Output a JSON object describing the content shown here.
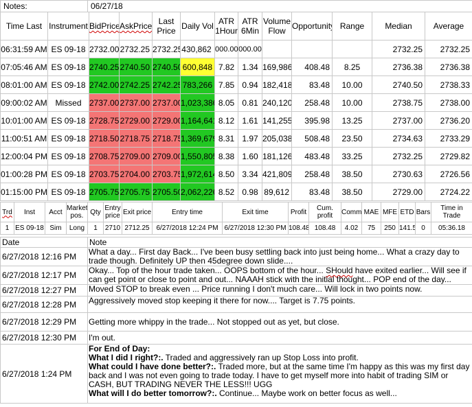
{
  "notes_bar": {
    "label": "Notes:",
    "date": "06/27/18"
  },
  "grid": {
    "headers": {
      "time_last": "Time Last",
      "instrument": "Instrument",
      "bid": "BidPrice",
      "ask": "AskPrice",
      "last": "Last Price",
      "daily_vol": "Daily Vol",
      "atr1": "ATR 1Hour",
      "atr6": "ATR 6Min",
      "volume_flow": "Volume Flow",
      "opportunity": "Opportunity",
      "range": "Range",
      "median": "Median",
      "average": "Average"
    },
    "rows": [
      {
        "time": "06:31:59 AM",
        "inst": "ES 09-18",
        "bid": "2732.00",
        "ask": "2732.25",
        "last": "2732.25",
        "vol": "430,862",
        "atr1": "000.00",
        "atr6": "000.00",
        "flow": "",
        "opp": "",
        "range": "",
        "median": "2732.25",
        "avg": "2732.25"
      },
      {
        "time": "07:05:46 AM",
        "inst": "ES 09-18",
        "bid": "2740.25",
        "ask": "2740.50",
        "last": "2740.50",
        "vol": "600,848",
        "atr1": "7.82",
        "atr6": "1.34",
        "flow": "169,986",
        "opp": "408.48",
        "range": "8.25",
        "median": "2736.38",
        "avg": "2736.38"
      },
      {
        "time": "08:01:00 AM",
        "inst": "ES 09-18",
        "bid": "2742.00",
        "ask": "2742.25",
        "last": "2742.25",
        "vol": "783,266",
        "atr1": "7.85",
        "atr6": "0.94",
        "flow": "182,418",
        "opp": "83.48",
        "range": "10.00",
        "median": "2740.50",
        "avg": "2738.33"
      },
      {
        "time": "09:00:02 AM",
        "inst": "Missed",
        "bid": "2737.00",
        "ask": "2737.00",
        "last": "2737.00",
        "vol": "1,023,386",
        "atr1": "8.05",
        "atr6": "0.81",
        "flow": "240,120",
        "opp": "258.48",
        "range": "10.00",
        "median": "2738.75",
        "avg": "2738.00"
      },
      {
        "time": "10:01:00 AM",
        "inst": "ES 09-18",
        "bid": "2728.75",
        "ask": "2729.00",
        "last": "2729.00",
        "vol": "1,164,641",
        "atr1": "8.12",
        "atr6": "1.61",
        "flow": "141,255",
        "opp": "395.98",
        "range": "13.25",
        "median": "2737.00",
        "avg": "2736.20"
      },
      {
        "time": "11:00:51 AM",
        "inst": "ES 09-18",
        "bid": "2718.50",
        "ask": "2718.75",
        "last": "2718.75",
        "vol": "1,369,679",
        "atr1": "8.31",
        "atr6": "1.97",
        "flow": "205,038",
        "opp": "508.48",
        "range": "23.50",
        "median": "2734.63",
        "avg": "2733.29"
      },
      {
        "time": "12:00:04 PM",
        "inst": "ES 09-18",
        "bid": "2708.75",
        "ask": "2709.00",
        "last": "2709.00",
        "vol": "1,550,805",
        "atr1": "8.38",
        "atr6": "1.60",
        "flow": "181,126",
        "opp": "483.48",
        "range": "33.25",
        "median": "2732.25",
        "avg": "2729.82"
      },
      {
        "time": "01:00:28 PM",
        "inst": "ES 09-18",
        "bid": "2703.75",
        "ask": "2704.00",
        "last": "2703.75",
        "vol": "1,972,614",
        "atr1": "8.50",
        "atr6": "3.34",
        "flow": "421,809",
        "opp": "258.48",
        "range": "38.50",
        "median": "2730.63",
        "avg": "2726.56"
      },
      {
        "time": "01:15:00 PM",
        "inst": "ES 09-18",
        "bid": "2705.75",
        "ask": "2705.75",
        "last": "2705.50",
        "vol": "2,062,226",
        "atr1": "8.52",
        "atr6": "0.98",
        "flow": "89,612",
        "opp": "83.48",
        "range": "38.50",
        "median": "2729.00",
        "avg": "2724.22"
      }
    ]
  },
  "trade": {
    "headers": {
      "trd": "Trd",
      "inst": "Inst",
      "acct": "Acct",
      "market_pos": "Market pos.",
      "qty": "Qty",
      "entry_price": "Entry price",
      "exit_price": "Exit price",
      "entry_time": "Entry time",
      "exit_time": "Exit time",
      "profit": "Profit",
      "cum_profit": "Cum. profit",
      "comm": "Comm",
      "mae": "MAE",
      "mfe": "MFE",
      "etd": "ETD",
      "bars": "Bars",
      "time_in_trade": "Time in Trade"
    },
    "row": {
      "trd": "1",
      "inst": "ES 09-18",
      "acct": "Sim",
      "market_pos": "Long",
      "qty": "1",
      "entry_price": "2710",
      "exit_price": "2712.25",
      "entry_time": "6/27/2018 12:24 PM",
      "exit_time": "6/27/2018 12:30 PM",
      "profit": "108.48",
      "cum_profit": "108.48",
      "comm": "4.02",
      "mae": "75",
      "mfe": "250",
      "etd": "141.5",
      "bars": "0",
      "time_in_trade": "05:36.18"
    }
  },
  "journal": {
    "headers": {
      "date": "Date",
      "note": "Note"
    },
    "entries": [
      {
        "date": "6/27/2018 12:16 PM",
        "note": "What a day... First day Back... I've been busy settling back into just being home... What a crazy day to trade though. Definitely UP then 45degree down slide...."
      },
      {
        "date": "6/27/2018 12:17 PM",
        "note": "Okay... Top of the hour trade taken... OOPS bottom of the hour... SHould have exited earlier... Will see if can get point or close to point and out... NAAAH stick with the initial thought... POP end of the day..."
      },
      {
        "date": "6/27/2018 12:27 PM",
        "note": "Moved STOP to break even ... Price running I don't much care... Will lock in two points now."
      },
      {
        "date": "6/27/2018 12:28 PM",
        "note": "Aggressively moved stop keeping it there for now.... Target is 7.75 points."
      },
      {
        "date": "6/27/2018 12:29 PM",
        "note": "Getting more whippy in the trade... Not stopped out as yet, but close."
      },
      {
        "date": "6/27/2018 12:30 PM",
        "note": "I'm out."
      }
    ],
    "final": {
      "date": "6/27/2018 1:24 PM",
      "heading": "For End of Day:",
      "q1": "What I did I right?:.",
      "a1": " Traded and aggressively ran up Stop Loss into profit.",
      "q2": "What could I have done better?:.",
      "a2": " Traded more, but at the same time I'm happy as this was my first day back and I was not even going to trade today.  I have to get myself more into habit of trading SIM or CASH, BUT TRADING NEVER THE LESS!!! UGG",
      "q3": "What will I do better tomorrow?:.",
      "a3": " Continue... Maybe work on better focus as well..."
    }
  },
  "colors": {
    "green": "#22c822",
    "red": "#f47575",
    "yellow": "#ffff33"
  }
}
